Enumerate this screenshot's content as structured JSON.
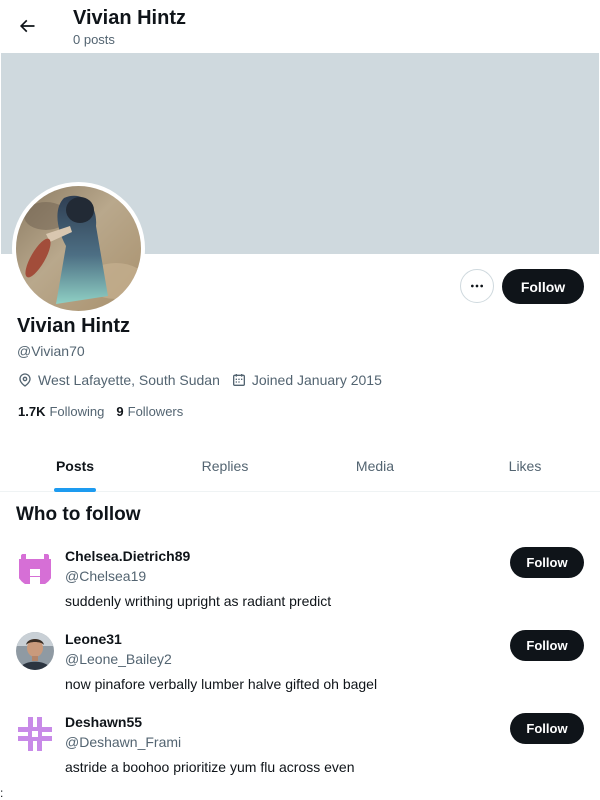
{
  "header": {
    "title": "Vivian Hintz",
    "post_count": "0 posts",
    "back_icon": "arrow-left-icon"
  },
  "profile": {
    "banner_color": "#cfd9de",
    "display_name": "Vivian Hintz",
    "handle": "@Vivian70",
    "location": "West Lafayette, South Sudan",
    "joined": "Joined January 2015",
    "following_count": "1.7K",
    "following_label": "Following",
    "followers_count": "9",
    "followers_label": "Followers",
    "follow_label": "Follow",
    "more_icon": "more-horizontal-icon"
  },
  "tabs": [
    {
      "label": "Posts",
      "active": true
    },
    {
      "label": "Replies",
      "active": false
    },
    {
      "label": "Media",
      "active": false
    },
    {
      "label": "Likes",
      "active": false
    }
  ],
  "who_to_follow": {
    "title": "Who to follow",
    "users": [
      {
        "name": "Chelsea.Dietrich89",
        "handle": "@Chelsea19",
        "bio": "suddenly writhing upright as radiant predict",
        "follow_label": "Follow"
      },
      {
        "name": "Leone31",
        "handle": "@Leone_Bailey2",
        "bio": "now pinafore verbally lumber halve gifted oh bagel",
        "follow_label": "Follow"
      },
      {
        "name": "Deshawn55",
        "handle": "@Deshawn_Frami",
        "bio": "astride a boohoo prioritize yum flu across even",
        "follow_label": "Follow"
      }
    ]
  },
  "colors": {
    "accent": "#1d9bf0",
    "button": "#0f1419",
    "identicon_pink": "#d66fd6",
    "identicon_violet": "#c88ae8"
  },
  "page_fragment": ":"
}
